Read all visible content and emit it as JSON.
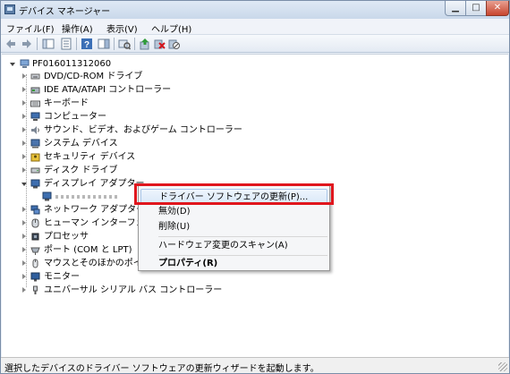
{
  "window": {
    "title": "デバイス マネージャー"
  },
  "menu": [
    "ファイル(F)",
    "操作(A)",
    "表示(V)",
    "ヘルプ(H)"
  ],
  "toolbar_icons": [
    "back-arrow-icon",
    "forward-arrow-icon",
    "console-tree-icon",
    "properties-icon",
    "help-icon",
    "show-panel-icon",
    "scan-hardware-icon",
    "update-driver-icon",
    "uninstall-icon",
    "disable-icon"
  ],
  "tree": {
    "root": "PF016011312060",
    "items": [
      {
        "label": "DVD/CD-ROM ドライブ",
        "icon": "dvd-drive-icon",
        "expanded": false
      },
      {
        "label": "IDE ATA/ATAPI コントローラー",
        "icon": "ide-controller-icon",
        "expanded": false
      },
      {
        "label": "キーボード",
        "icon": "keyboard-icon",
        "expanded": false
      },
      {
        "label": "コンピューター",
        "icon": "computer-icon",
        "expanded": false
      },
      {
        "label": "サウンド、ビデオ、およびゲーム コントローラー",
        "icon": "speaker-icon",
        "expanded": false
      },
      {
        "label": "システム デバイス",
        "icon": "system-device-icon",
        "expanded": false
      },
      {
        "label": "セキュリティ デバイス",
        "icon": "security-device-icon",
        "expanded": false
      },
      {
        "label": "ディスク ドライブ",
        "icon": "disk-drive-icon",
        "expanded": false
      },
      {
        "label": "ディスプレイ アダプター",
        "icon": "display-adapter-icon",
        "expanded": true
      },
      {
        "label": "ネットワーク アダプター",
        "icon": "network-adapter-icon",
        "expanded": false
      },
      {
        "label": "ヒューマン インターフェイ",
        "icon": "hid-icon",
        "expanded": false
      },
      {
        "label": "プロセッサ",
        "icon": "processor-icon",
        "expanded": false
      },
      {
        "label": "ポート (COM と LPT)",
        "icon": "port-icon",
        "expanded": false
      },
      {
        "label": "マウスとそのほかのポイン",
        "icon": "mouse-icon",
        "expanded": false
      },
      {
        "label": "モニター",
        "icon": "monitor-icon",
        "expanded": false
      },
      {
        "label": "ユニバーサル シリアル バス コントローラー",
        "icon": "usb-icon",
        "expanded": false
      }
    ]
  },
  "context_menu": {
    "items": [
      {
        "label": "ドライバー ソフトウェアの更新(P)...",
        "highlighted": true
      },
      {
        "label": "無効(D)"
      },
      {
        "label": "削除(U)"
      },
      {
        "label": "ハードウェア変更のスキャン(A)"
      },
      {
        "label": "プロパティ(R)",
        "bold": true
      }
    ]
  },
  "status": {
    "text": "選択したデバイスのドライバー ソフトウェアの更新ウィザードを起動します。"
  },
  "colors": {
    "highlight_border": "#e0161d",
    "title_gradient_top": "#dfe9f5",
    "menu_hover": "#dae8f8"
  }
}
